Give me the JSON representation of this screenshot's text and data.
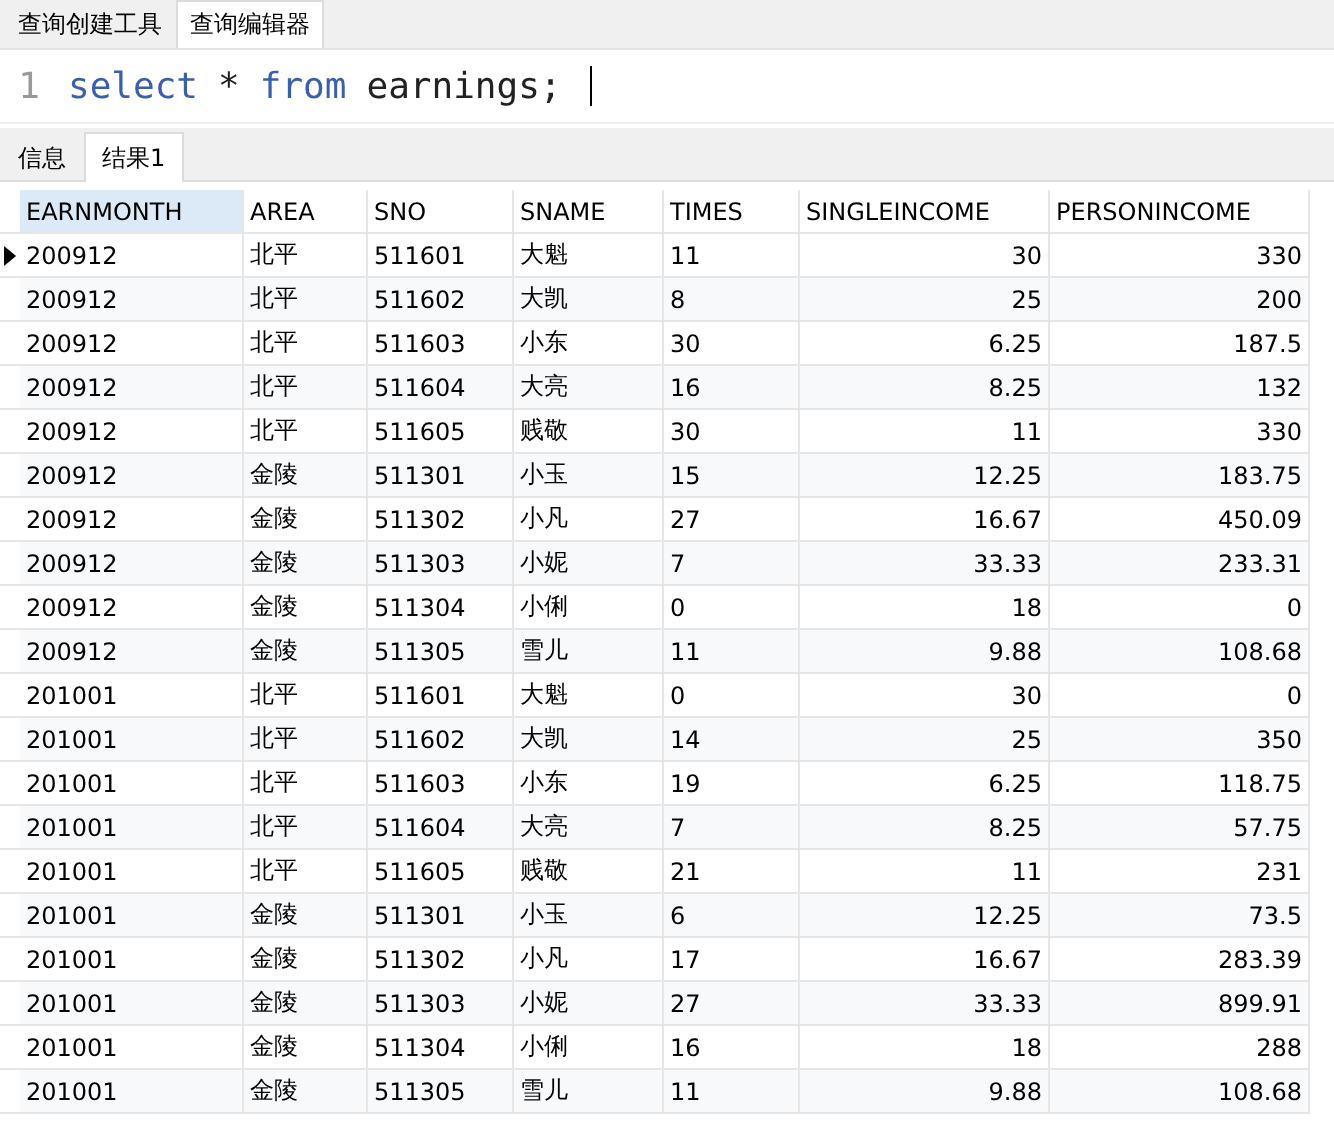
{
  "editor_tabs": [
    {
      "label": "查询创建工具",
      "selected": false
    },
    {
      "label": "查询编辑器",
      "selected": true
    }
  ],
  "editor": {
    "line_number": "1",
    "tokens": [
      {
        "text": "select",
        "kind": "keyword"
      },
      {
        "text": "*",
        "kind": "plain"
      },
      {
        "text": "from",
        "kind": "keyword"
      },
      {
        "text": "earnings;",
        "kind": "plain"
      }
    ]
  },
  "result_tabs": [
    {
      "label": "信息",
      "selected": false
    },
    {
      "label": "结果1",
      "selected": true
    }
  ],
  "table": {
    "columns": [
      {
        "label": "EARNMONTH",
        "kind": "text",
        "selected": true
      },
      {
        "label": "AREA",
        "kind": "text",
        "selected": false
      },
      {
        "label": "SNO",
        "kind": "text",
        "selected": false
      },
      {
        "label": "SNAME",
        "kind": "text",
        "selected": false
      },
      {
        "label": "TIMES",
        "kind": "text",
        "selected": false
      },
      {
        "label": "SINGLEINCOME",
        "kind": "decimal",
        "selected": false
      },
      {
        "label": "PERSONINCOME",
        "kind": "decimal",
        "selected": false
      }
    ],
    "rows": [
      {
        "current": true,
        "cells": [
          "200912",
          "北平",
          "511601",
          "大魁",
          "11",
          "30",
          "330"
        ]
      },
      {
        "current": false,
        "cells": [
          "200912",
          "北平",
          "511602",
          "大凯",
          "8",
          "25",
          "200"
        ]
      },
      {
        "current": false,
        "cells": [
          "200912",
          "北平",
          "511603",
          "小东",
          "30",
          "6.25",
          "187.5"
        ]
      },
      {
        "current": false,
        "cells": [
          "200912",
          "北平",
          "511604",
          "大亮",
          "16",
          "8.25",
          "132"
        ]
      },
      {
        "current": false,
        "cells": [
          "200912",
          "北平",
          "511605",
          "贱敬",
          "30",
          "11",
          "330"
        ]
      },
      {
        "current": false,
        "cells": [
          "200912",
          "金陵",
          "511301",
          "小玉",
          "15",
          "12.25",
          "183.75"
        ]
      },
      {
        "current": false,
        "cells": [
          "200912",
          "金陵",
          "511302",
          "小凡",
          "27",
          "16.67",
          "450.09"
        ]
      },
      {
        "current": false,
        "cells": [
          "200912",
          "金陵",
          "511303",
          "小妮",
          "7",
          "33.33",
          "233.31"
        ]
      },
      {
        "current": false,
        "cells": [
          "200912",
          "金陵",
          "511304",
          "小俐",
          "0",
          "18",
          "0"
        ]
      },
      {
        "current": false,
        "cells": [
          "200912",
          "金陵",
          "511305",
          "雪儿",
          "11",
          "9.88",
          "108.68"
        ]
      },
      {
        "current": false,
        "cells": [
          "201001",
          "北平",
          "511601",
          "大魁",
          "0",
          "30",
          "0"
        ]
      },
      {
        "current": false,
        "cells": [
          "201001",
          "北平",
          "511602",
          "大凯",
          "14",
          "25",
          "350"
        ]
      },
      {
        "current": false,
        "cells": [
          "201001",
          "北平",
          "511603",
          "小东",
          "19",
          "6.25",
          "118.75"
        ]
      },
      {
        "current": false,
        "cells": [
          "201001",
          "北平",
          "511604",
          "大亮",
          "7",
          "8.25",
          "57.75"
        ]
      },
      {
        "current": false,
        "cells": [
          "201001",
          "北平",
          "511605",
          "贱敬",
          "21",
          "11",
          "231"
        ]
      },
      {
        "current": false,
        "cells": [
          "201001",
          "金陵",
          "511301",
          "小玉",
          "6",
          "12.25",
          "73.5"
        ]
      },
      {
        "current": false,
        "cells": [
          "201001",
          "金陵",
          "511302",
          "小凡",
          "17",
          "16.67",
          "283.39"
        ]
      },
      {
        "current": false,
        "cells": [
          "201001",
          "金陵",
          "511303",
          "小妮",
          "27",
          "33.33",
          "899.91"
        ]
      },
      {
        "current": false,
        "cells": [
          "201001",
          "金陵",
          "511304",
          "小俐",
          "16",
          "18",
          "288"
        ]
      },
      {
        "current": false,
        "cells": [
          "201001",
          "金陵",
          "511305",
          "雪儿",
          "11",
          "9.88",
          "108.68"
        ]
      }
    ]
  }
}
